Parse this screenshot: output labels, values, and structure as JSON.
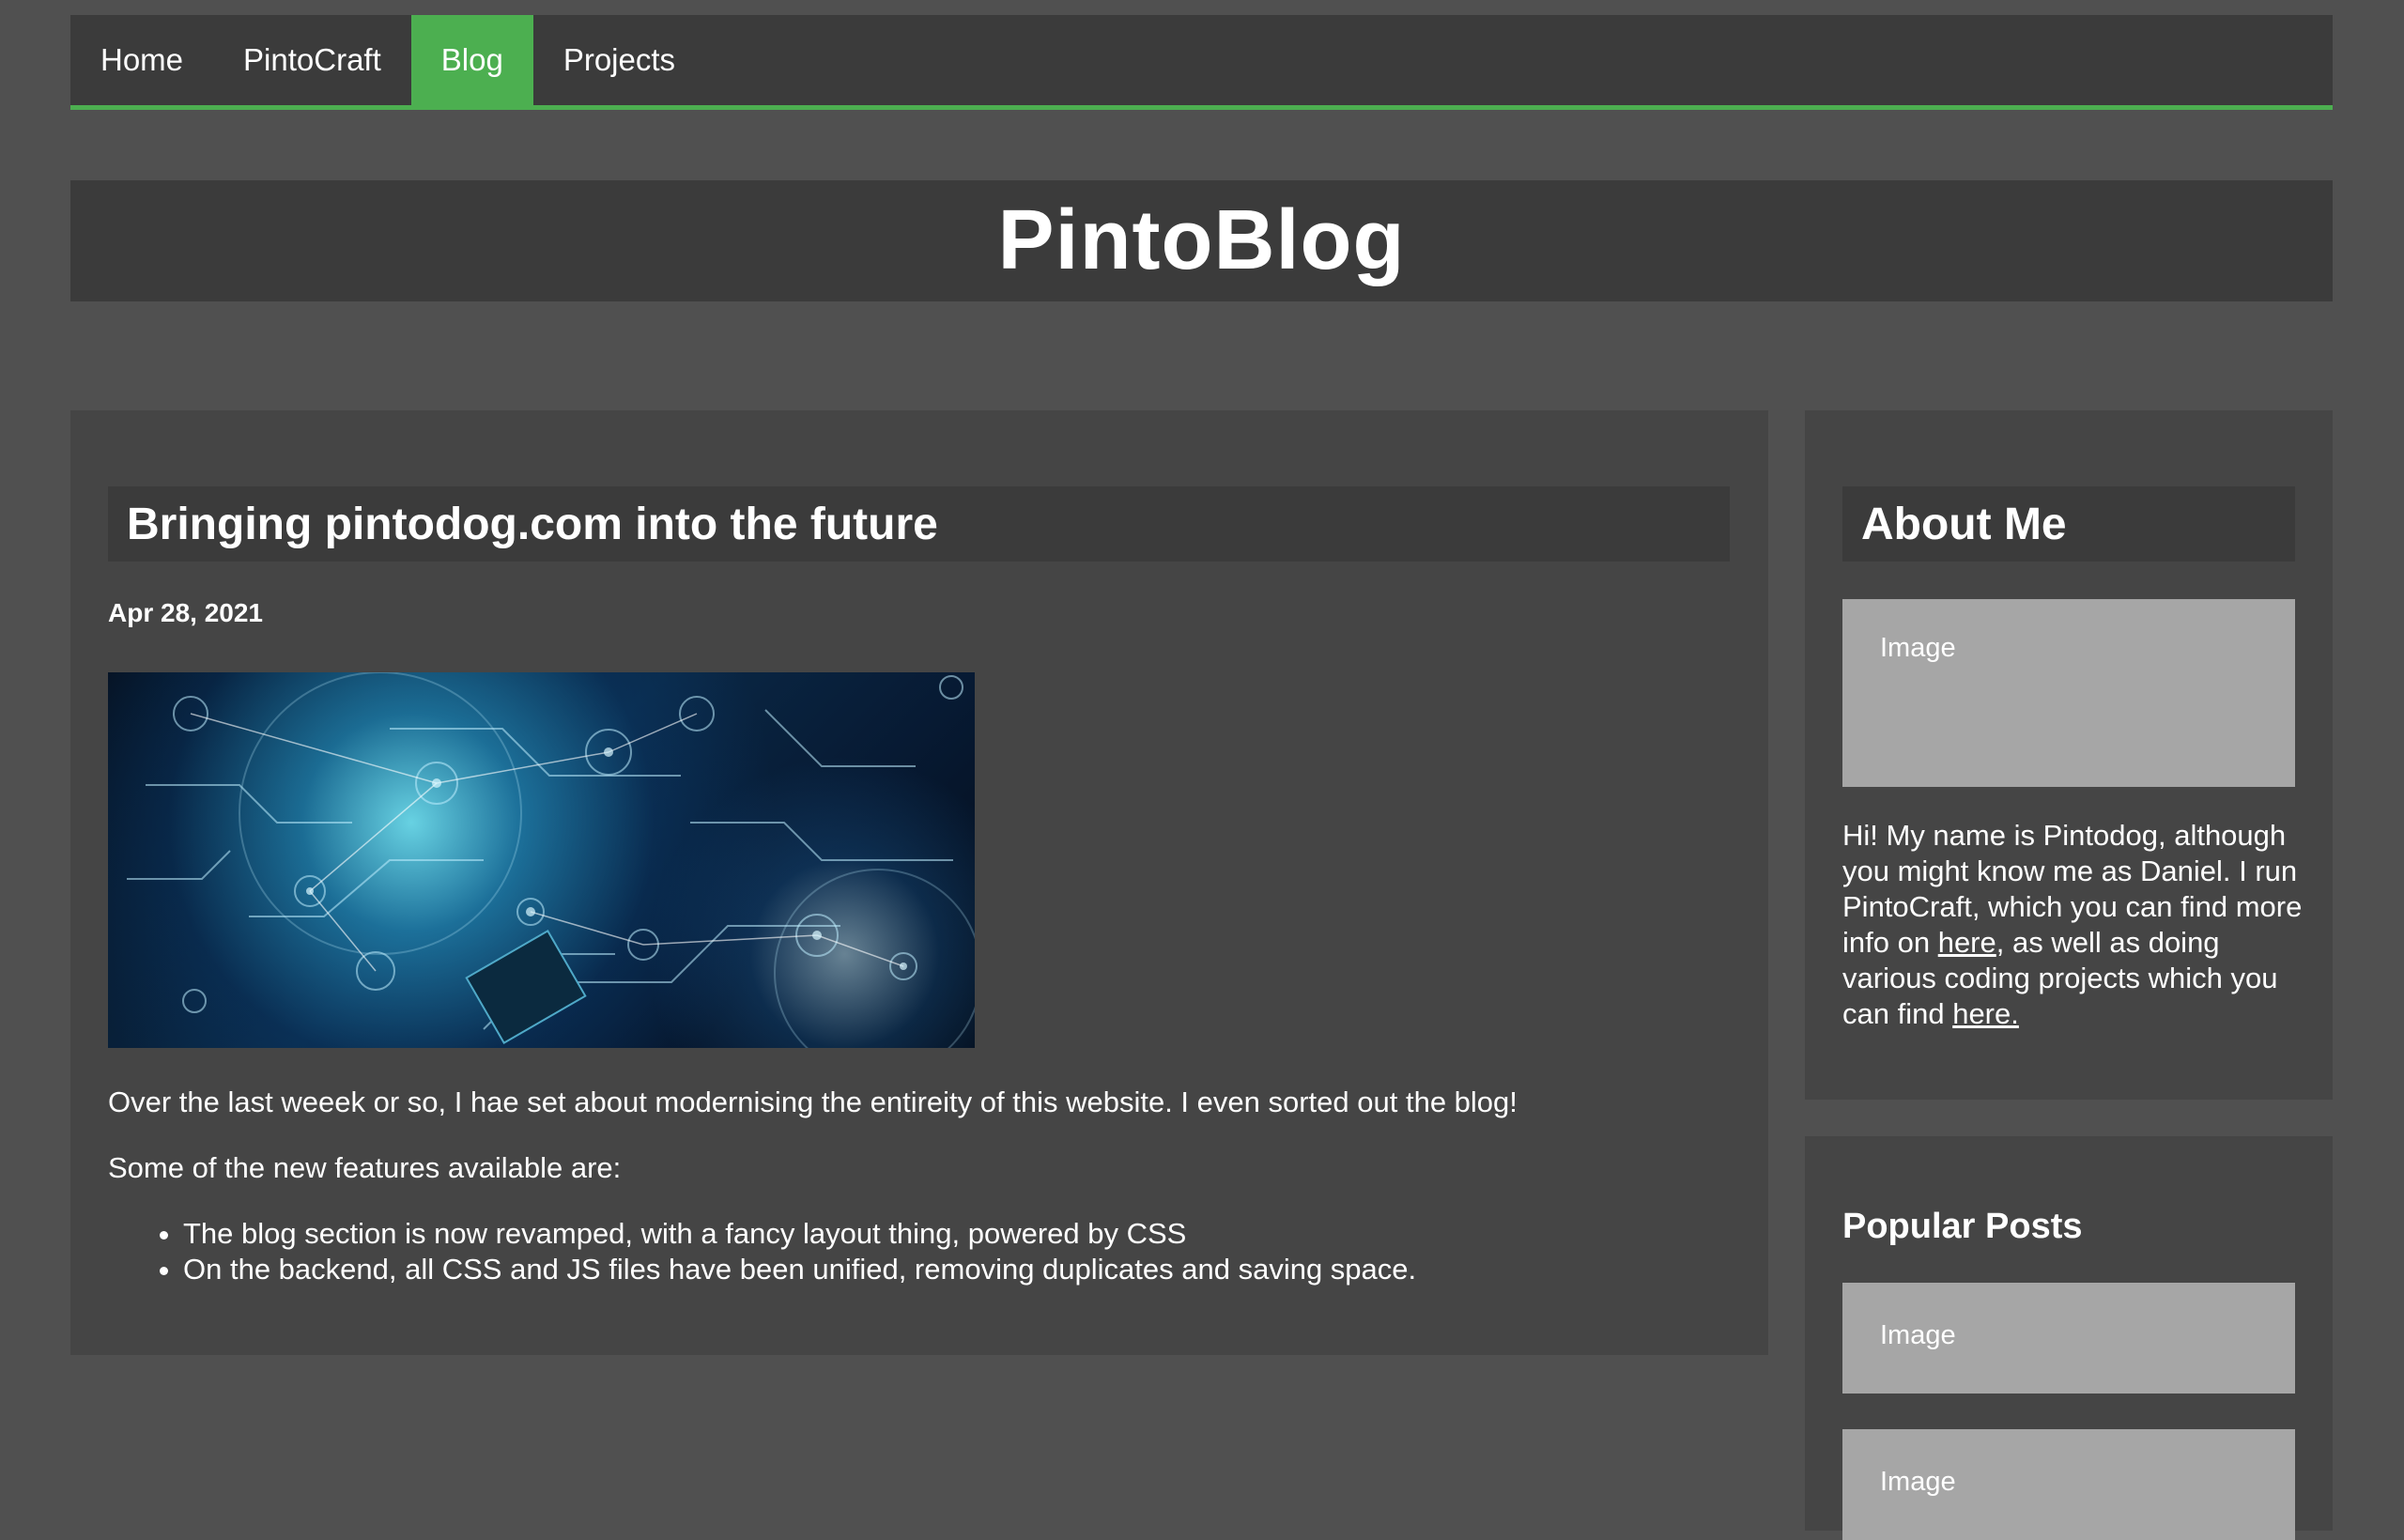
{
  "nav": {
    "items": [
      {
        "label": "Home",
        "active": false
      },
      {
        "label": "PintoCraft",
        "active": false
      },
      {
        "label": "Blog",
        "active": true
      },
      {
        "label": "Projects",
        "active": false
      }
    ]
  },
  "header": {
    "title": "PintoBlog"
  },
  "post": {
    "title": "Bringing pintodog.com into the future",
    "date": "Apr 28, 2021",
    "paragraph1": "Over the last weeek or so, I hae set about modernising the entireity of this website. I even sorted out the blog!",
    "paragraph2": "Some of the new features available are:",
    "features": [
      "The blog section is now revamped, with a fancy layout thing, powered by CSS",
      "On the backend, all CSS and JS files have been unified, removing duplicates and saving space."
    ]
  },
  "sidebar": {
    "about": {
      "heading": "About Me",
      "image_label": "Image",
      "text_1": "Hi! My name is Pintodog, although you might know me as Daniel. I run PintoCraft, which you can find more info on ",
      "link_1": "here",
      "text_2": ", as well as doing various coding projects which you can find ",
      "link_2": "here."
    },
    "popular": {
      "heading": "Popular Posts",
      "image_labels": [
        "Image",
        "Image"
      ]
    }
  },
  "colors": {
    "accent": "#4caf50",
    "page_bg": "#505050",
    "card_bg": "#454545",
    "bar_bg": "#3b3b3b",
    "placeholder_bg": "#a6a6a6"
  }
}
